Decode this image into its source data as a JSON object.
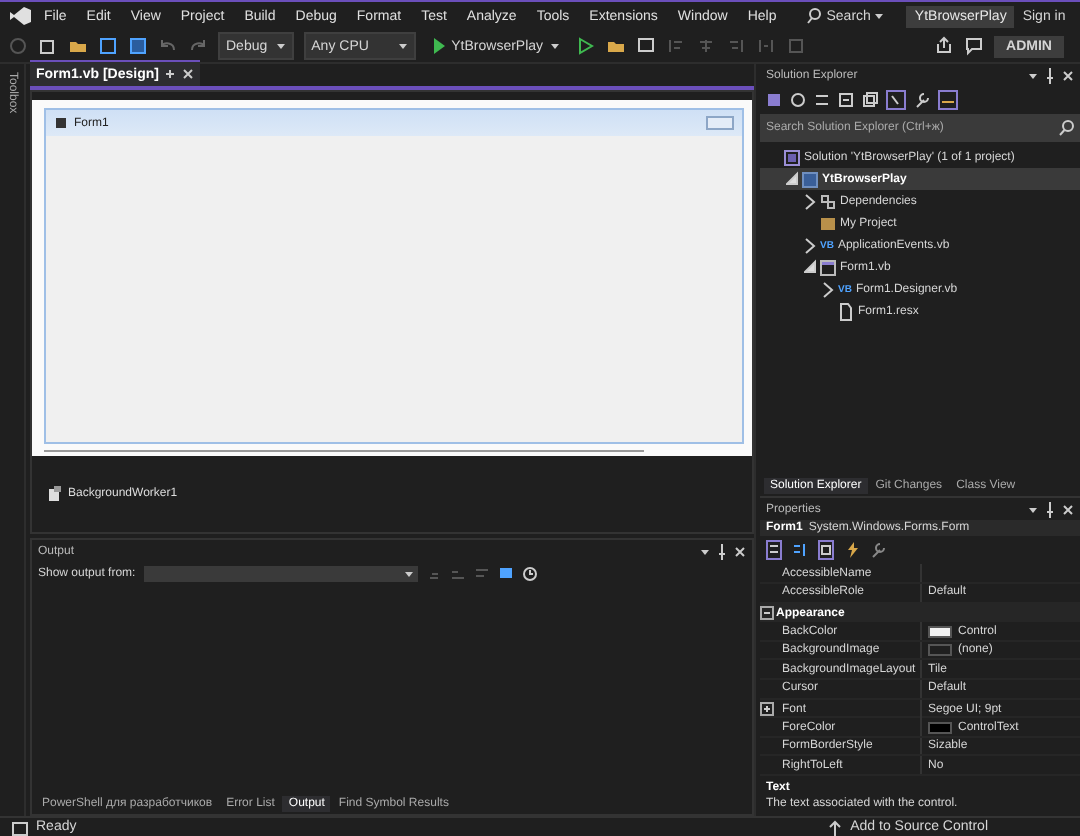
{
  "menu": {
    "items": [
      "File",
      "Edit",
      "View",
      "Project",
      "Build",
      "Debug",
      "Format",
      "Test",
      "Analyze",
      "Tools",
      "Extensions",
      "Window",
      "Help"
    ],
    "search": "Search",
    "solution_name": "YtBrowserPlay",
    "sign_in": "Sign in"
  },
  "toolbar": {
    "configuration": "Debug",
    "platform": "Any CPU",
    "start_target": "YtBrowserPlay",
    "admin": "ADMIN"
  },
  "toolbox_label": "Toolbox",
  "document_tabs": [
    {
      "label": "Form1.vb [Design]",
      "selected": true
    }
  ],
  "designer": {
    "form_title": "Form1",
    "components": [
      "BackgroundWorker1"
    ]
  },
  "output": {
    "title": "Output",
    "show_output_from": "Show output from:",
    "tabs": [
      {
        "label": "PowerShell для разработчиков",
        "selected": false
      },
      {
        "label": "Error List",
        "selected": false
      },
      {
        "label": "Output",
        "selected": true
      },
      {
        "label": "Find Symbol Results",
        "selected": false
      }
    ]
  },
  "solution_explorer": {
    "title": "Solution Explorer",
    "search_placeholder": "Search Solution Explorer (Ctrl+ж)",
    "tree": [
      {
        "label": "Solution 'YtBrowserPlay' (1 of 1 project)",
        "kind": "solution",
        "selected": false,
        "children": [
          {
            "label": "YtBrowserPlay",
            "kind": "project",
            "expanded": true,
            "selected": true,
            "children": [
              {
                "label": "Dependencies",
                "kind": "dependencies",
                "expanded": false,
                "selected": false
              },
              {
                "label": "My Project",
                "kind": "myproject",
                "selected": false
              },
              {
                "label": "ApplicationEvents.vb",
                "kind": "vb",
                "badge": "VB",
                "expanded": false,
                "selected": false
              },
              {
                "label": "Form1.vb",
                "kind": "form",
                "expanded": true,
                "selected": false,
                "children": [
                  {
                    "label": "Form1.Designer.vb",
                    "kind": "vb",
                    "badge": "VB",
                    "expanded": false,
                    "selected": false
                  },
                  {
                    "label": "Form1.resx",
                    "kind": "resx",
                    "selected": false
                  }
                ]
              }
            ]
          }
        ]
      }
    ],
    "tabs": [
      {
        "label": "Solution Explorer",
        "selected": true
      },
      {
        "label": "Git Changes",
        "selected": false
      },
      {
        "label": "Class View",
        "selected": false
      }
    ]
  },
  "properties": {
    "title": "Properties",
    "object_name": "Form1",
    "object_type": "System.Windows.Forms.Form",
    "rows": [
      {
        "kind": "property",
        "name": "AccessibleName"
      },
      {
        "kind": "property",
        "name": "AccessibleRole",
        "value": "Default"
      },
      {
        "kind": "category",
        "name": "Appearance",
        "expanded": true
      },
      {
        "kind": "property",
        "name": "BackColor",
        "value": "Control",
        "color": "#f0f0f0"
      },
      {
        "kind": "property",
        "name": "BackgroundImage",
        "value": "(none)",
        "color": "#1f1f1f"
      },
      {
        "kind": "property",
        "name": "BackgroundImageLayout",
        "value": "Tile"
      },
      {
        "kind": "property",
        "name": "Cursor",
        "value": "Default"
      },
      {
        "kind": "group",
        "name": "Font",
        "value": "Segoe UI; 9pt",
        "expanded": false
      },
      {
        "kind": "property",
        "name": "ForeColor",
        "value": "ControlText",
        "color": "#000000"
      },
      {
        "kind": "property",
        "name": "FormBorderStyle",
        "value": "Sizable"
      },
      {
        "kind": "property",
        "name": "RightToLeft",
        "value": "No"
      }
    ],
    "description_title": "Text",
    "description": "The text associated with the control."
  },
  "status_bar": {
    "left": "Ready",
    "right": "Add to Source Control"
  }
}
